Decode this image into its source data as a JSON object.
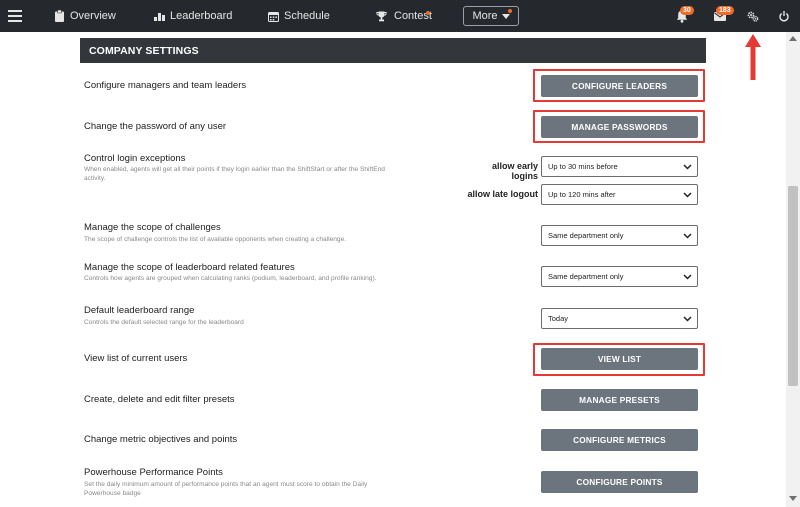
{
  "nav": {
    "overview": "Overview",
    "leaderboard": "Leaderboard",
    "schedule": "Schedule",
    "contest": "Contest",
    "more": "More",
    "notification_count": "30",
    "message_count": "183"
  },
  "settings": {
    "section_title": "COMPANY SETTINGS",
    "rows": [
      {
        "title": "Configure managers and team leaders",
        "button": "CONFIGURE LEADERS"
      },
      {
        "title": "Change the password of any user",
        "button": "MANAGE PASSWORDS"
      },
      {
        "title": "Control login exceptions",
        "desc": "When enabled, agents will get all their points if they login earlier than the ShiftStart or after the ShiftEnd activity.",
        "early_label": "allow early logins",
        "early_value": "Up to 30 mins before",
        "late_label": "allow late logout",
        "late_value": "Up to 120 mins after"
      },
      {
        "title": "Manage the scope of challenges",
        "desc": "The scope of challenge controls the list of available opponents when creating a challenge.",
        "value": "Same department only"
      },
      {
        "title": "Manage the scope of leaderboard related features",
        "desc": "Controls how agents are grouped when calculating ranks (podium, leaderboard, and profile ranking).",
        "value": "Same department only"
      },
      {
        "title": "Default leaderboard range",
        "desc": "Controls the default selected range for the leaderboard",
        "value": "Today"
      },
      {
        "title": "View list of current users",
        "button": "VIEW LIST"
      },
      {
        "title": "Create, delete and edit filter presets",
        "button": "MANAGE PRESETS"
      },
      {
        "title": "Change metric objectives and points",
        "button": "CONFIGURE METRICS"
      },
      {
        "title": "Powerhouse Performance Points",
        "desc": "Set the daily minimum amount of performance points that an agent must score to obtain the Daily Powerhouse badge",
        "button": "CONFIGURE POINTS"
      }
    ]
  },
  "colors": {
    "nav_bg": "#25292e",
    "header_bg": "#33373c",
    "button_bg": "#6c757d",
    "highlight": "#e53935",
    "badge": "#ef6b2a"
  }
}
